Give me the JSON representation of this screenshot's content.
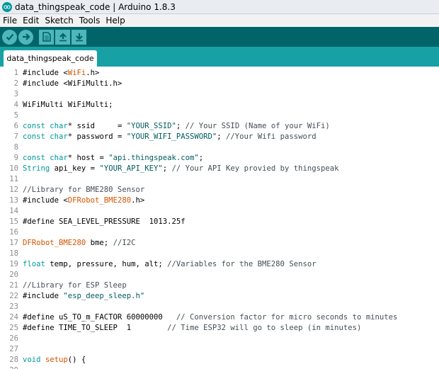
{
  "window": {
    "title": "data_thingspeak_code | Arduino 1.8.3",
    "accent": "#00979c"
  },
  "menu": [
    "File",
    "Edit",
    "Sketch",
    "Tools",
    "Help"
  ],
  "toolbar": {
    "buttons": [
      "verify-icon",
      "upload-icon",
      "new-icon",
      "open-icon",
      "save-icon"
    ]
  },
  "tab": {
    "label": "data_thingspeak_code"
  },
  "code_lines": [
    {
      "n": "1",
      "parts": [
        [
          "#include <",
          ""
        ],
        [
          "WiFi",
          "red"
        ],
        [
          ".h>",
          ""
        ]
      ]
    },
    {
      "n": "2",
      "parts": [
        [
          "#include <WiFiMulti.h>",
          ""
        ]
      ]
    },
    {
      "n": "3",
      "parts": []
    },
    {
      "n": "4",
      "parts": [
        [
          "WiFiMulti WiFiMulti;",
          ""
        ]
      ]
    },
    {
      "n": "5",
      "parts": []
    },
    {
      "n": "6",
      "parts": [
        [
          "const",
          "kw"
        ],
        [
          " ",
          ""
        ],
        [
          "char",
          "kw"
        ],
        [
          "* ssid     = ",
          ""
        ],
        [
          "\"YOUR_SSID\"",
          "str"
        ],
        [
          "; ",
          ""
        ],
        [
          "// Your SSID (Name of your WiFi)",
          "cm"
        ]
      ]
    },
    {
      "n": "7",
      "parts": [
        [
          "const",
          "kw"
        ],
        [
          " ",
          ""
        ],
        [
          "char",
          "kw"
        ],
        [
          "* password = ",
          ""
        ],
        [
          "\"YOUR_WIFI_PASSWORD\"",
          "str"
        ],
        [
          "; ",
          ""
        ],
        [
          "//Your Wifi password",
          "cm"
        ]
      ]
    },
    {
      "n": "8",
      "parts": []
    },
    {
      "n": "9",
      "parts": [
        [
          "const",
          "kw"
        ],
        [
          " ",
          ""
        ],
        [
          "char",
          "kw"
        ],
        [
          "* host = ",
          ""
        ],
        [
          "\"api.thingspeak.com\"",
          "str"
        ],
        [
          ";",
          ""
        ]
      ]
    },
    {
      "n": "10",
      "parts": [
        [
          "String",
          "kw"
        ],
        [
          " api_key = ",
          ""
        ],
        [
          "\"YOUR_API_KEY\"",
          "str"
        ],
        [
          "; ",
          ""
        ],
        [
          "// Your API Key provied by thingspeak",
          "cm"
        ]
      ]
    },
    {
      "n": "11",
      "parts": []
    },
    {
      "n": "12",
      "parts": [
        [
          "//Library for BME280 Sensor",
          "cm"
        ]
      ]
    },
    {
      "n": "13",
      "parts": [
        [
          "#include <",
          ""
        ],
        [
          "DFRobot_BME280",
          "red"
        ],
        [
          ".h>",
          ""
        ]
      ]
    },
    {
      "n": "14",
      "parts": []
    },
    {
      "n": "15",
      "parts": [
        [
          "#define SEA_LEVEL_PRESSURE  1013.25f",
          ""
        ]
      ]
    },
    {
      "n": "16",
      "parts": []
    },
    {
      "n": "17",
      "parts": [
        [
          "DFRobot_BME280",
          "red"
        ],
        [
          " bme; ",
          ""
        ],
        [
          "//I2C",
          "cm"
        ]
      ]
    },
    {
      "n": "18",
      "parts": []
    },
    {
      "n": "19",
      "parts": [
        [
          "float",
          "kw"
        ],
        [
          " temp, pressure, hum, alt; ",
          ""
        ],
        [
          "//Variables for the BME280 Sensor",
          "cm"
        ]
      ]
    },
    {
      "n": "20",
      "parts": []
    },
    {
      "n": "21",
      "parts": [
        [
          "//Library for ESP Sleep",
          "cm"
        ]
      ]
    },
    {
      "n": "22",
      "parts": [
        [
          "#include ",
          ""
        ],
        [
          "\"esp_deep_sleep.h\"",
          "str"
        ]
      ]
    },
    {
      "n": "23",
      "parts": []
    },
    {
      "n": "24",
      "parts": [
        [
          "#define uS_TO_m_FACTOR 60000000   ",
          ""
        ],
        [
          "// Conversion factor for micro seconds to minutes",
          "cm"
        ]
      ]
    },
    {
      "n": "25",
      "parts": [
        [
          "#define TIME_TO_SLEEP  1        ",
          ""
        ],
        [
          "// Time ESP32 will go to sleep (in minutes)",
          "cm"
        ]
      ]
    },
    {
      "n": "26",
      "parts": []
    },
    {
      "n": "27",
      "parts": []
    },
    {
      "n": "28",
      "parts": [
        [
          "void",
          "kw"
        ],
        [
          " ",
          ""
        ],
        [
          "setup",
          "red"
        ],
        [
          "() {",
          ""
        ]
      ]
    },
    {
      "n": "29",
      "parts": []
    }
  ]
}
